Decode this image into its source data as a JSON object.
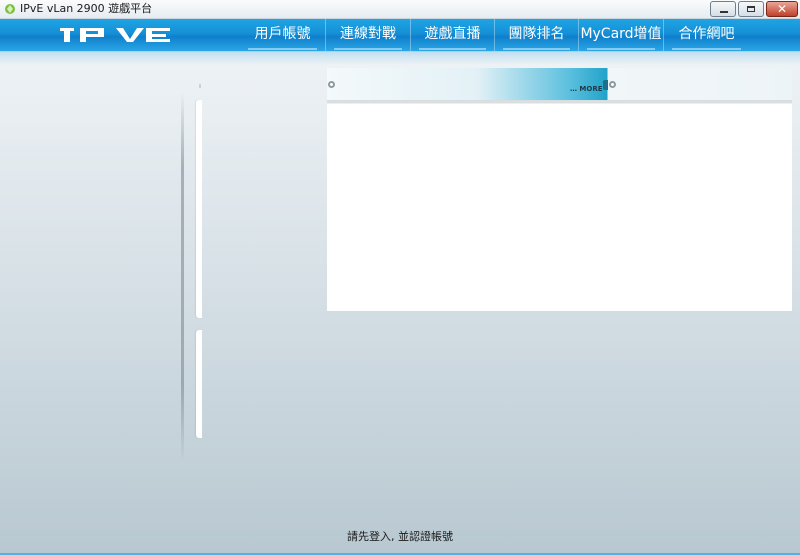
{
  "window": {
    "title": "IPvE vLan 2900 遊戲平台",
    "close_glyph": "✕"
  },
  "nav": {
    "items": [
      {
        "label": "用戶帳號"
      },
      {
        "label": "連線對戰"
      },
      {
        "label": "遊戲直播"
      },
      {
        "label": "團隊排名"
      },
      {
        "label": "MyCard增值"
      },
      {
        "label": "合作網吧"
      }
    ]
  },
  "panel": {
    "more_label": "… MORE"
  },
  "status": {
    "message": "請先登入, 並認證帳號"
  },
  "colors": {
    "nav_blue": "#1590d6",
    "accent_teal": "#21a3c9"
  },
  "icons": {
    "app": "leaf-gear-icon",
    "minimize": "minimize-icon",
    "maximize": "maximize-icon",
    "close": "close-icon"
  }
}
